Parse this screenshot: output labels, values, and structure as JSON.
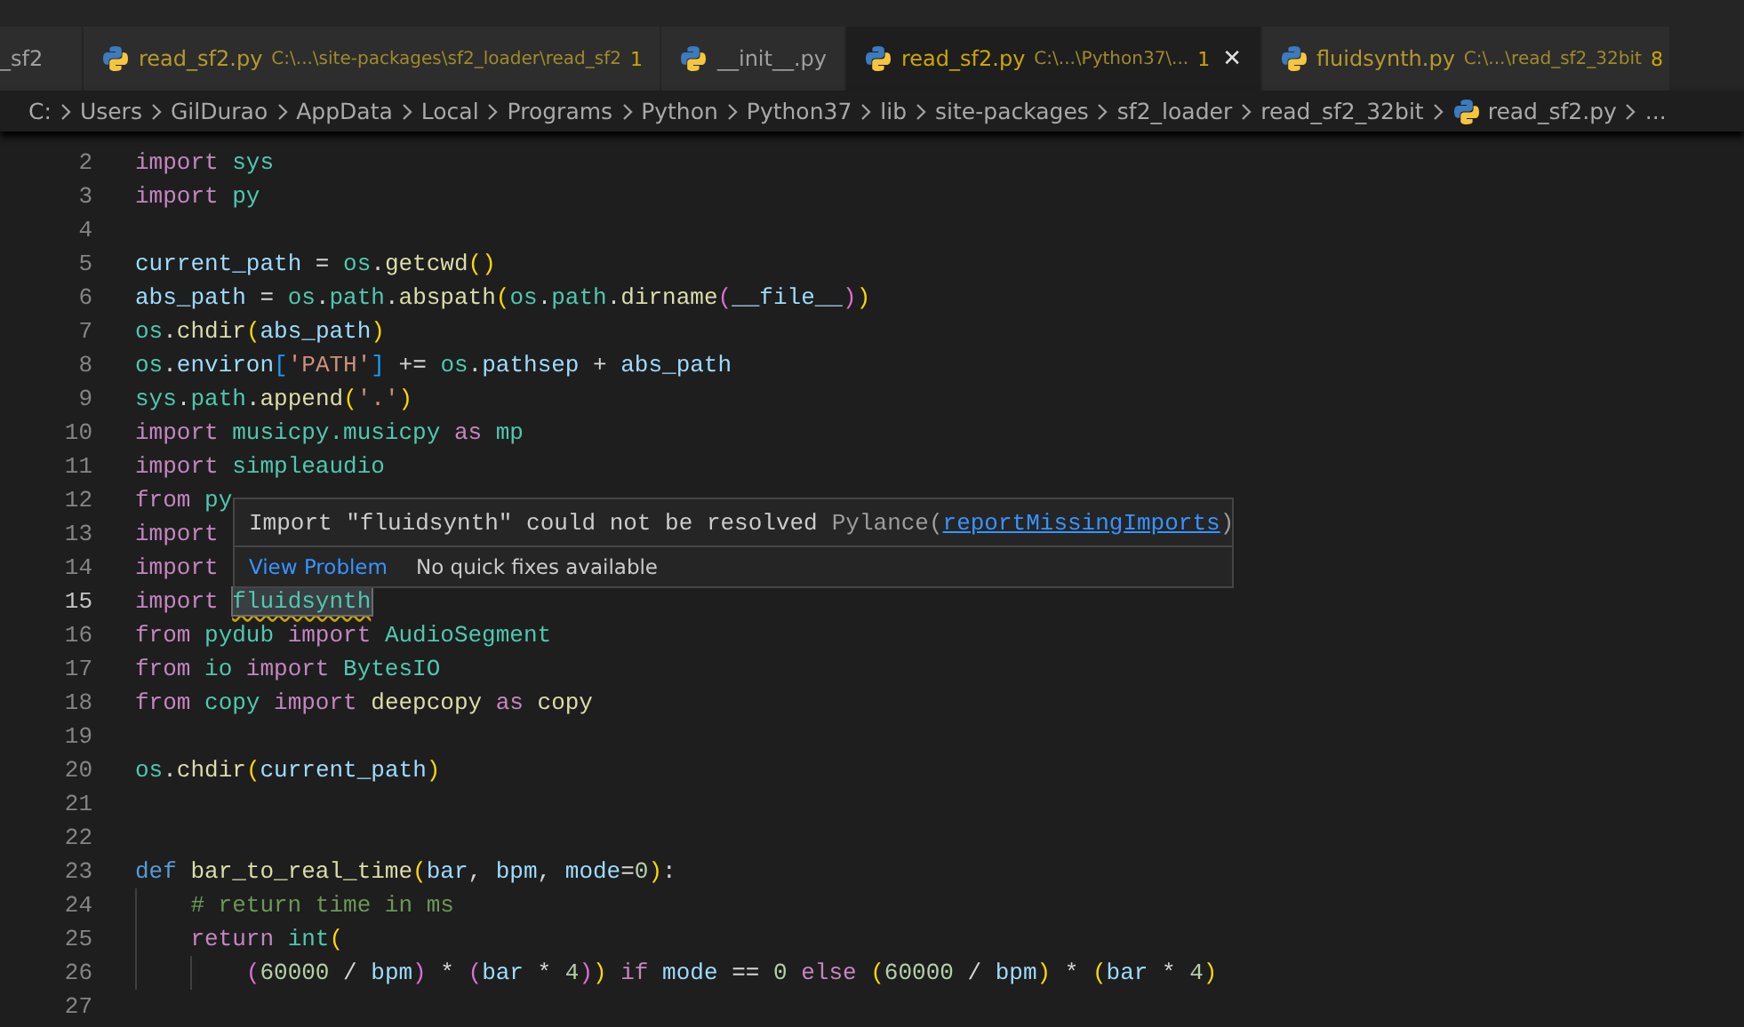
{
  "tabs": [
    {
      "kind": "clipped",
      "name": "_sf2",
      "selected": false
    },
    {
      "kind": "file",
      "name": "read_sf2.py",
      "description": "C:\\...\\site-packages\\sf2_loader\\read_sf2",
      "problems": "1",
      "selected": false,
      "warning": true
    },
    {
      "kind": "file",
      "name": "__init__.py",
      "selected": false,
      "warning": false
    },
    {
      "kind": "file",
      "name": "read_sf2.py",
      "description": "C:\\...\\Python37\\...",
      "problems": "1",
      "selected": true,
      "warning": true,
      "close": "✕"
    },
    {
      "kind": "file",
      "name": "fluidsynth.py",
      "description": "C:\\...\\read_sf2_32bit",
      "problems": "8",
      "selected": false,
      "warning": true
    }
  ],
  "breadcrumb": [
    {
      "text": "C:"
    },
    {
      "text": "Users"
    },
    {
      "text": "GilDurao"
    },
    {
      "text": "AppData"
    },
    {
      "text": "Local"
    },
    {
      "text": "Programs"
    },
    {
      "text": "Python"
    },
    {
      "text": "Python37"
    },
    {
      "text": "lib"
    },
    {
      "text": "site-packages"
    },
    {
      "text": "sf2_loader"
    },
    {
      "text": "read_sf2_32bit"
    },
    {
      "text": "read_sf2.py",
      "kind": "file"
    },
    {
      "text": "..."
    }
  ],
  "editor": {
    "lines": [
      {
        "number": "2",
        "tokens": [
          {
            "kind": "kw",
            "text": "import "
          },
          {
            "kind": "mod",
            "text": "sys"
          }
        ]
      },
      {
        "number": "3",
        "tokens": [
          {
            "kind": "kw",
            "text": "import "
          },
          {
            "kind": "mod",
            "text": "py"
          }
        ]
      },
      {
        "number": "4"
      },
      {
        "number": "5",
        "tokens": [
          {
            "kind": "var",
            "text": "current_path "
          },
          {
            "kind": "op",
            "text": "= "
          },
          {
            "kind": "mod",
            "text": "os"
          },
          {
            "kind": "op",
            "text": "."
          },
          {
            "kind": "fn",
            "text": "getcwd"
          },
          {
            "kind": "b1",
            "text": "()"
          }
        ]
      },
      {
        "number": "6",
        "tokens": [
          {
            "kind": "var",
            "text": "abs_path "
          },
          {
            "kind": "op",
            "text": "= "
          },
          {
            "kind": "mod",
            "text": "os"
          },
          {
            "kind": "op",
            "text": "."
          },
          {
            "kind": "mod",
            "text": "path"
          },
          {
            "kind": "op",
            "text": "."
          },
          {
            "kind": "fn",
            "text": "abspath"
          },
          {
            "kind": "b1",
            "text": "("
          },
          {
            "kind": "mod",
            "text": "os"
          },
          {
            "kind": "op",
            "text": "."
          },
          {
            "kind": "mod",
            "text": "path"
          },
          {
            "kind": "op",
            "text": "."
          },
          {
            "kind": "fn",
            "text": "dirname"
          },
          {
            "kind": "b2",
            "text": "("
          },
          {
            "kind": "var",
            "text": "__file__"
          },
          {
            "kind": "b2",
            "text": ")"
          },
          {
            "kind": "b1",
            "text": ")"
          }
        ]
      },
      {
        "number": "7",
        "tokens": [
          {
            "kind": "mod",
            "text": "os"
          },
          {
            "kind": "op",
            "text": "."
          },
          {
            "kind": "fn",
            "text": "chdir"
          },
          {
            "kind": "b1",
            "text": "("
          },
          {
            "kind": "var",
            "text": "abs_path"
          },
          {
            "kind": "b1",
            "text": ")"
          }
        ]
      },
      {
        "number": "8",
        "tokens": [
          {
            "kind": "mod",
            "text": "os"
          },
          {
            "kind": "op",
            "text": "."
          },
          {
            "kind": "var",
            "text": "environ"
          },
          {
            "kind": "b3",
            "text": "["
          },
          {
            "kind": "str",
            "text": "'PATH'"
          },
          {
            "kind": "b3",
            "text": "]"
          },
          {
            "kind": "op",
            "text": " += "
          },
          {
            "kind": "mod",
            "text": "os"
          },
          {
            "kind": "op",
            "text": "."
          },
          {
            "kind": "var",
            "text": "pathsep"
          },
          {
            "kind": "op",
            "text": " + "
          },
          {
            "kind": "var",
            "text": "abs_path"
          }
        ]
      },
      {
        "number": "9",
        "tokens": [
          {
            "kind": "mod",
            "text": "sys"
          },
          {
            "kind": "op",
            "text": "."
          },
          {
            "kind": "mod",
            "text": "path"
          },
          {
            "kind": "op",
            "text": "."
          },
          {
            "kind": "fn",
            "text": "append"
          },
          {
            "kind": "b1",
            "text": "("
          },
          {
            "kind": "str",
            "text": "'.'"
          },
          {
            "kind": "b1",
            "text": ")"
          }
        ]
      },
      {
        "number": "10",
        "tokens": [
          {
            "kind": "kw",
            "text": "import "
          },
          {
            "kind": "mod",
            "text": "musicpy.musicpy "
          },
          {
            "kind": "kw",
            "text": "as "
          },
          {
            "kind": "mod",
            "text": "mp"
          }
        ]
      },
      {
        "number": "11",
        "tokens": [
          {
            "kind": "kw",
            "text": "import "
          },
          {
            "kind": "mod",
            "text": "simpleaudio"
          }
        ]
      },
      {
        "number": "12",
        "tokens": [
          {
            "kind": "kw",
            "text": "from "
          },
          {
            "kind": "mod",
            "text": "py"
          }
        ]
      },
      {
        "number": "13",
        "tokens": [
          {
            "kind": "kw",
            "text": "import"
          }
        ]
      },
      {
        "number": "14",
        "tokens": [
          {
            "kind": "kw",
            "text": "import"
          }
        ]
      },
      {
        "number": "15",
        "current": true,
        "tokens": [
          {
            "kind": "kw",
            "text": "import "
          },
          {
            "kind": "unresolved",
            "text": "fluidsynth"
          }
        ]
      },
      {
        "number": "16",
        "tokens": [
          {
            "kind": "kw",
            "text": "from "
          },
          {
            "kind": "mod",
            "text": "pydub "
          },
          {
            "kind": "kw",
            "text": "import "
          },
          {
            "kind": "mod",
            "text": "AudioSegment"
          }
        ]
      },
      {
        "number": "17",
        "tokens": [
          {
            "kind": "kw",
            "text": "from "
          },
          {
            "kind": "mod",
            "text": "io "
          },
          {
            "kind": "kw",
            "text": "import "
          },
          {
            "kind": "mod",
            "text": "BytesIO"
          }
        ]
      },
      {
        "number": "18",
        "tokens": [
          {
            "kind": "kw",
            "text": "from "
          },
          {
            "kind": "mod",
            "text": "copy "
          },
          {
            "kind": "kw",
            "text": "import "
          },
          {
            "kind": "fn",
            "text": "deepcopy "
          },
          {
            "kind": "kw",
            "text": "as "
          },
          {
            "kind": "fn",
            "text": "copy"
          }
        ]
      },
      {
        "number": "19"
      },
      {
        "number": "20",
        "tokens": [
          {
            "kind": "mod",
            "text": "os"
          },
          {
            "kind": "op",
            "text": "."
          },
          {
            "kind": "fn",
            "text": "chdir"
          },
          {
            "kind": "b1",
            "text": "("
          },
          {
            "kind": "var",
            "text": "current_path"
          },
          {
            "kind": "b1",
            "text": ")"
          }
        ]
      },
      {
        "number": "21"
      },
      {
        "number": "22"
      },
      {
        "number": "23",
        "tokens": [
          {
            "kind": "def",
            "text": "def "
          },
          {
            "kind": "fn",
            "text": "bar_to_real_time"
          },
          {
            "kind": "b1",
            "text": "("
          },
          {
            "kind": "var",
            "text": "bar"
          },
          {
            "kind": "op",
            "text": ", "
          },
          {
            "kind": "var",
            "text": "bpm"
          },
          {
            "kind": "op",
            "text": ", "
          },
          {
            "kind": "var",
            "text": "mode"
          },
          {
            "kind": "op",
            "text": "="
          },
          {
            "kind": "num",
            "text": "0"
          },
          {
            "kind": "b1",
            "text": ")"
          },
          {
            "kind": "op",
            "text": ":"
          }
        ]
      },
      {
        "number": "24",
        "guides": [
          {
            "kind": "indent"
          }
        ],
        "tokens": [
          {
            "kind": "comment",
            "text": "# return time in ms"
          }
        ]
      },
      {
        "number": "25",
        "guides": [
          {
            "kind": "indent"
          }
        ],
        "tokens": [
          {
            "kind": "kw",
            "text": "return "
          },
          {
            "kind": "mod",
            "text": "int"
          },
          {
            "kind": "b1",
            "text": "("
          }
        ]
      },
      {
        "number": "26",
        "guides": [
          {
            "kind": "indent"
          },
          {
            "kind": "indent"
          }
        ],
        "tokens": [
          {
            "kind": "b2",
            "text": "("
          },
          {
            "kind": "num",
            "text": "60000"
          },
          {
            "kind": "op",
            "text": " / "
          },
          {
            "kind": "var",
            "text": "bpm"
          },
          {
            "kind": "b2",
            "text": ")"
          },
          {
            "kind": "op",
            "text": " * "
          },
          {
            "kind": "b2",
            "text": "("
          },
          {
            "kind": "var",
            "text": "bar"
          },
          {
            "kind": "op",
            "text": " * "
          },
          {
            "kind": "num",
            "text": "4"
          },
          {
            "kind": "b2",
            "text": ")"
          },
          {
            "kind": "b1",
            "text": ")"
          },
          {
            "kind": "kw",
            "text": " if "
          },
          {
            "kind": "var",
            "text": "mode"
          },
          {
            "kind": "op",
            "text": " == "
          },
          {
            "kind": "num",
            "text": "0"
          },
          {
            "kind": "kw",
            "text": " else "
          },
          {
            "kind": "b1",
            "text": "("
          },
          {
            "kind": "num",
            "text": "60000"
          },
          {
            "kind": "op",
            "text": " / "
          },
          {
            "kind": "var",
            "text": "bpm"
          },
          {
            "kind": "b1",
            "text": ")"
          },
          {
            "kind": "op",
            "text": " * "
          },
          {
            "kind": "b1",
            "text": "("
          },
          {
            "kind": "var",
            "text": "bar"
          },
          {
            "kind": "op",
            "text": " * "
          },
          {
            "kind": "num",
            "text": "4"
          },
          {
            "kind": "b1",
            "text": ")"
          }
        ]
      },
      {
        "number": "27"
      }
    ]
  },
  "hover": {
    "message": "Import \"fluidsynth\" could not be resolved",
    "source": "Pylance(",
    "code": "reportMissingImports",
    "source_end": ")",
    "action": "View Problem",
    "note": "No quick fixes available"
  }
}
